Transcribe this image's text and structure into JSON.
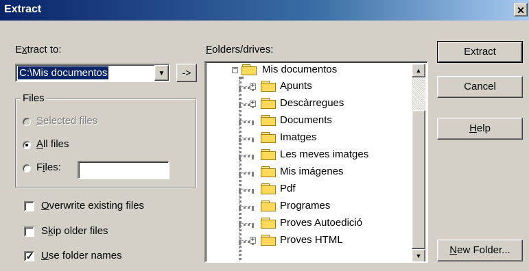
{
  "window": {
    "title": "Extract",
    "close_glyph": "✕"
  },
  "extract_to": {
    "label_pre": "E",
    "label_accel": "x",
    "label_post": "tract to:",
    "value": "C:\\Mis documentos",
    "dropdown_glyph": "▼",
    "browse_label": "->"
  },
  "files_group": {
    "title": "Files",
    "options": [
      {
        "accel": "S",
        "rest": "elected files",
        "selected": false,
        "disabled": true
      },
      {
        "accel": "A",
        "rest": "ll files",
        "selected": true,
        "disabled": false
      },
      {
        "pre": "F",
        "accel": "i",
        "rest": "les:",
        "selected": false,
        "disabled": false
      }
    ],
    "files_value": ""
  },
  "checkboxes": [
    {
      "pre": "",
      "accel": "O",
      "rest": "verwrite existing files",
      "checked": false
    },
    {
      "pre": "S",
      "accel": "k",
      "rest": "ip older files",
      "checked": false
    },
    {
      "pre": "",
      "accel": "U",
      "rest": "se folder names",
      "checked": true
    }
  ],
  "folders": {
    "label_accel": "F",
    "label_rest": "olders/drives:",
    "root": {
      "name": "Mis documentos",
      "toggle": "−"
    },
    "items": [
      {
        "name": "Apunts",
        "toggle": "+"
      },
      {
        "name": "Descàrregues",
        "toggle": "+"
      },
      {
        "name": "Documents",
        "toggle": ""
      },
      {
        "name": "Imatges",
        "toggle": ""
      },
      {
        "name": "Les meves imatges",
        "toggle": ""
      },
      {
        "name": "Mis imágenes",
        "toggle": ""
      },
      {
        "name": "Pdf",
        "toggle": ""
      },
      {
        "name": "Programes",
        "toggle": ""
      },
      {
        "name": "Proves Autoedició",
        "toggle": ""
      },
      {
        "name": "Proves HTML",
        "toggle": "+"
      }
    ],
    "scroll_up": "▲",
    "scroll_down": "▼"
  },
  "buttons": {
    "extract": "Extract",
    "cancel": "Cancel",
    "help_accel": "H",
    "help_rest": "elp",
    "new_folder_accel": "N",
    "new_folder_rest": "ew Folder..."
  }
}
